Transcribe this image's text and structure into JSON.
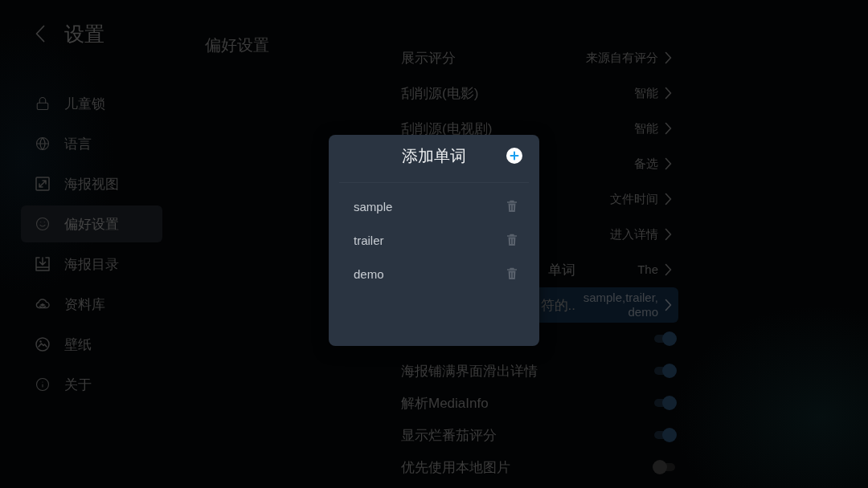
{
  "sidebar": {
    "title": "设置",
    "items": [
      {
        "label": "儿童锁",
        "selected": false
      },
      {
        "label": "语言",
        "selected": false
      },
      {
        "label": "海报视图",
        "selected": false
      },
      {
        "label": "偏好设置",
        "selected": true
      },
      {
        "label": "海报目录",
        "selected": false
      },
      {
        "label": "资料库",
        "selected": false
      },
      {
        "label": "壁纸",
        "selected": false
      },
      {
        "label": "关于",
        "selected": false
      }
    ]
  },
  "page_title": "偏好设置",
  "settings": [
    {
      "kind": "choice",
      "label": "展示评分",
      "value": "来源自有评分",
      "selected": false
    },
    {
      "kind": "choice",
      "label": "刮削源(电影)",
      "value": "智能",
      "selected": false
    },
    {
      "kind": "choice",
      "label": "刮削源(电视剧)",
      "value": "智能",
      "selected": false
    },
    {
      "kind": "choice",
      "value": "备选",
      "selected": false
    },
    {
      "kind": "choice",
      "value": "文件时间",
      "selected": false
    },
    {
      "kind": "choice",
      "value": "进入详情",
      "selected": false
    },
    {
      "kind": "choice",
      "label_tail": "单词",
      "value": "The",
      "selected": false
    },
    {
      "kind": "choice",
      "label_tail": "符的..",
      "value": "sample,trailer,\ndemo",
      "selected": true
    },
    {
      "kind": "toggle",
      "on": true,
      "selected": false
    },
    {
      "kind": "toggle",
      "label": "海报铺满界面滑出详情",
      "on": true,
      "selected": false
    },
    {
      "kind": "toggle",
      "label": "解析MediaInfo",
      "on": true,
      "selected": false
    },
    {
      "kind": "toggle",
      "label": "显示烂番茄评分",
      "on": true,
      "selected": false
    },
    {
      "kind": "toggle",
      "label": "优先使用本地图片",
      "on": false,
      "selected": false
    }
  ],
  "dialog": {
    "title": "添加单词",
    "words": [
      "sample",
      "trailer",
      "demo"
    ]
  }
}
